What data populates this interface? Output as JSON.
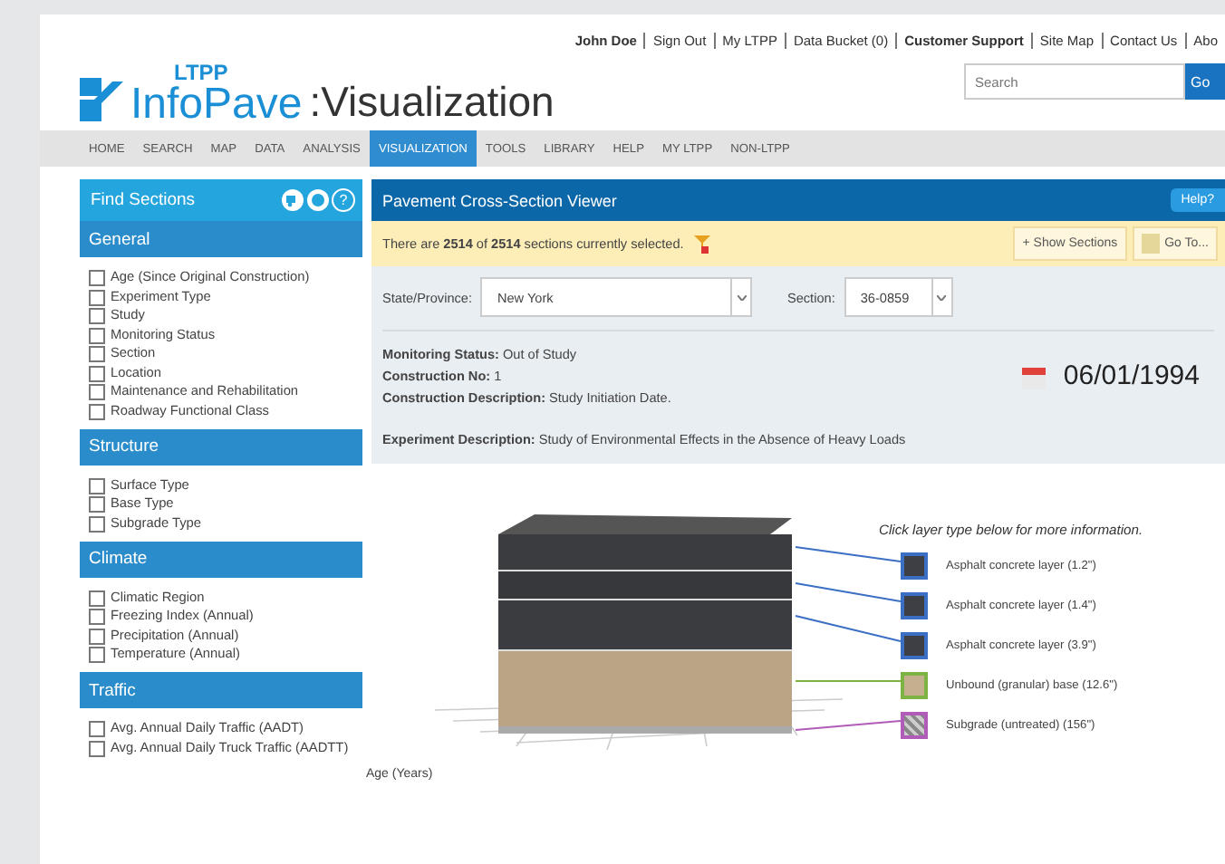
{
  "header": {
    "logo_small": "LTPP",
    "logo_main": "InfoPave",
    "logo_suffix": ":Visualization",
    "top_links": [
      {
        "label": "John Doe",
        "bold": true
      },
      {
        "label": "Sign Out",
        "bold": false
      },
      {
        "label": "My LTPP",
        "bold": false
      },
      {
        "label": "Data Bucket (0)",
        "bold": false
      },
      {
        "label": "Customer Support",
        "bold": true
      },
      {
        "label": "Site Map",
        "bold": false
      },
      {
        "label": "Contact Us",
        "bold": false
      },
      {
        "label": "Abo",
        "bold": false
      }
    ],
    "search": {
      "placeholder": "Search",
      "button": "Go"
    }
  },
  "nav": [
    {
      "label": "HOME",
      "selected": false
    },
    {
      "label": "SEARCH",
      "selected": false
    },
    {
      "label": "MAP",
      "selected": false
    },
    {
      "label": "DATA",
      "selected": false
    },
    {
      "label": "ANALYSIS",
      "selected": false
    },
    {
      "label": "VISUALIZATION",
      "selected": true
    },
    {
      "label": "TOOLS",
      "selected": false
    },
    {
      "label": "LIBRARY",
      "selected": false
    },
    {
      "label": "HELP",
      "selected": false
    },
    {
      "label": "MY LTPP",
      "selected": false
    },
    {
      "label": "NON-LTPP",
      "selected": false
    }
  ],
  "sidebar": {
    "title": "Find Sections",
    "help_icon": "?",
    "groups": [
      {
        "title": "General",
        "items": [
          {
            "label": "Age (Since Original Construction)",
            "checked": false
          },
          {
            "label": "Experiment Type",
            "checked": false
          },
          {
            "label": "Study",
            "checked": false
          },
          {
            "label": "Monitoring Status",
            "checked": false
          },
          {
            "label": "Section",
            "checked": false
          },
          {
            "label": "Location",
            "checked": false
          },
          {
            "label": "Maintenance and Rehabilitation",
            "checked": false
          },
          {
            "label": "Roadway Functional Class",
            "checked": false
          }
        ]
      },
      {
        "title": "Structure",
        "items": [
          {
            "label": "Surface Type",
            "checked": false
          },
          {
            "label": "Base Type",
            "checked": false
          },
          {
            "label": "Subgrade Type",
            "checked": false
          }
        ]
      },
      {
        "title": "Climate",
        "items": [
          {
            "label": "Climatic Region",
            "checked": false
          },
          {
            "label": "Freezing Index (Annual)",
            "checked": false
          },
          {
            "label": "Precipitation (Annual)",
            "checked": false
          },
          {
            "label": "Temperature (Annual)",
            "checked": false
          }
        ]
      },
      {
        "title": "Traffic",
        "items": [
          {
            "label": "Avg. Annual Daily Traffic (AADT)",
            "checked": false
          },
          {
            "label": "Avg. Annual Daily Truck Traffic (AADTT)",
            "checked": false
          }
        ]
      }
    ]
  },
  "viewer": {
    "title": "Pavement Cross-Section Viewer",
    "help": "Help?",
    "selection_text": "There are **2514** of **2514** sections currently selected.",
    "show_sections": "+ Show Sections",
    "goto": "Go To...",
    "state_label": "State/Province:",
    "state_value": "New York",
    "section_label": "Section:",
    "section_value": "36-0859",
    "info": [
      {
        "label": "Monitoring Status:",
        "value": "Out of Study"
      },
      {
        "label": "Construction No:",
        "value": "1"
      },
      {
        "label": "Construction Description:",
        "value": "Study Initiation Date."
      }
    ],
    "date": "06/01/1994",
    "experiment": {
      "label": "Experiment Description:",
      "value": "Study of Environmental Effects in the Absence of Heavy Loads"
    },
    "legend_title": "Click layer type below for more information.",
    "layers": [
      {
        "kind": "asphalt",
        "color": "#3b6fc4",
        "label": "Asphalt concrete layer (1.2\")"
      },
      {
        "kind": "asphalt",
        "color": "#3b6fc4",
        "label": "Asphalt concrete layer (1.4\")"
      },
      {
        "kind": "asphalt",
        "color": "#3b6fc4",
        "label": "Asphalt concrete layer (3.9\")"
      },
      {
        "kind": "base",
        "color": "#7cb342",
        "label": "Unbound (granular) base (12.6\")"
      },
      {
        "kind": "subgrade",
        "color": "#b05cb8",
        "label": "Subgrade (untreated) (156\")"
      }
    ],
    "axis_label": "Age (Years)"
  }
}
